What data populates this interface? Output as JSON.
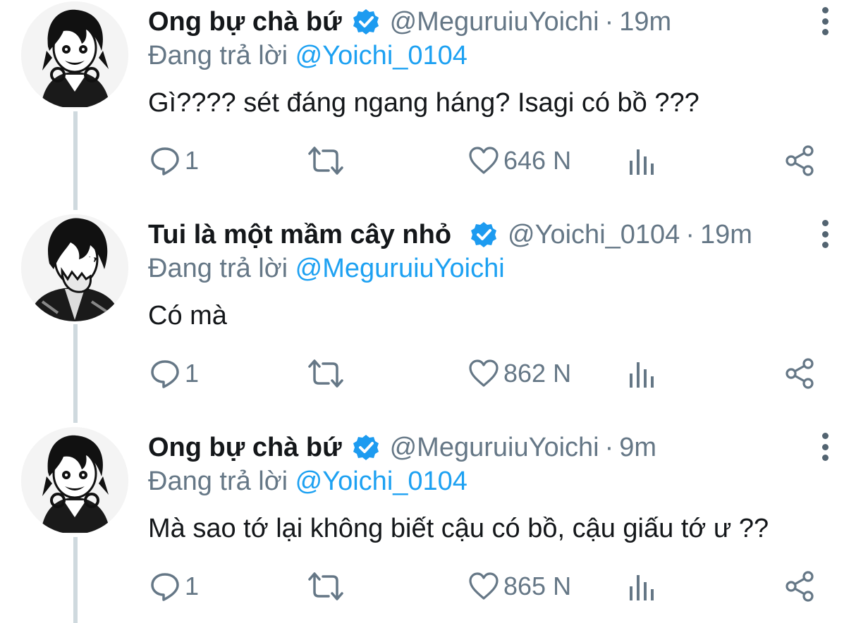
{
  "reply_prefix": "Đang trả lời",
  "tweets": [
    {
      "name": "Ong bự chà bứ",
      "handle": "@MeguruiuYoichi",
      "time": "19m",
      "reply_to": "@Yoichi_0104",
      "text": "Gì???? sét đáng ngang háng? Isagi có bồ ???",
      "replies": "1",
      "likes": "646 N"
    },
    {
      "name": "Tui là một mầm cây nhỏ",
      "handle": "@Yoichi_0104",
      "time": "19m",
      "reply_to": "@MeguruiuYoichi",
      "text": "Có mà",
      "replies": "1",
      "likes": "862 N"
    },
    {
      "name": "Ong bự chà bứ",
      "handle": "@MeguruiuYoichi",
      "time": "9m",
      "reply_to": "@Yoichi_0104",
      "text": "Mà sao tớ lại không biết cậu có bồ, cậu giấu tớ ư ??",
      "replies": "1",
      "likes": "865 N"
    }
  ],
  "colors": {
    "link": "#1da1f2",
    "muted": "#657786",
    "verified": "#1d9bf0",
    "thread_line": "#cfd9de"
  },
  "icons": {
    "reply": "speech-bubble-icon",
    "retweet": "retweet-icon",
    "like": "heart-icon",
    "stats": "bar-chart-icon",
    "share": "share-icon",
    "verified": "verified-badge-icon",
    "more": "more-vertical-icon"
  }
}
